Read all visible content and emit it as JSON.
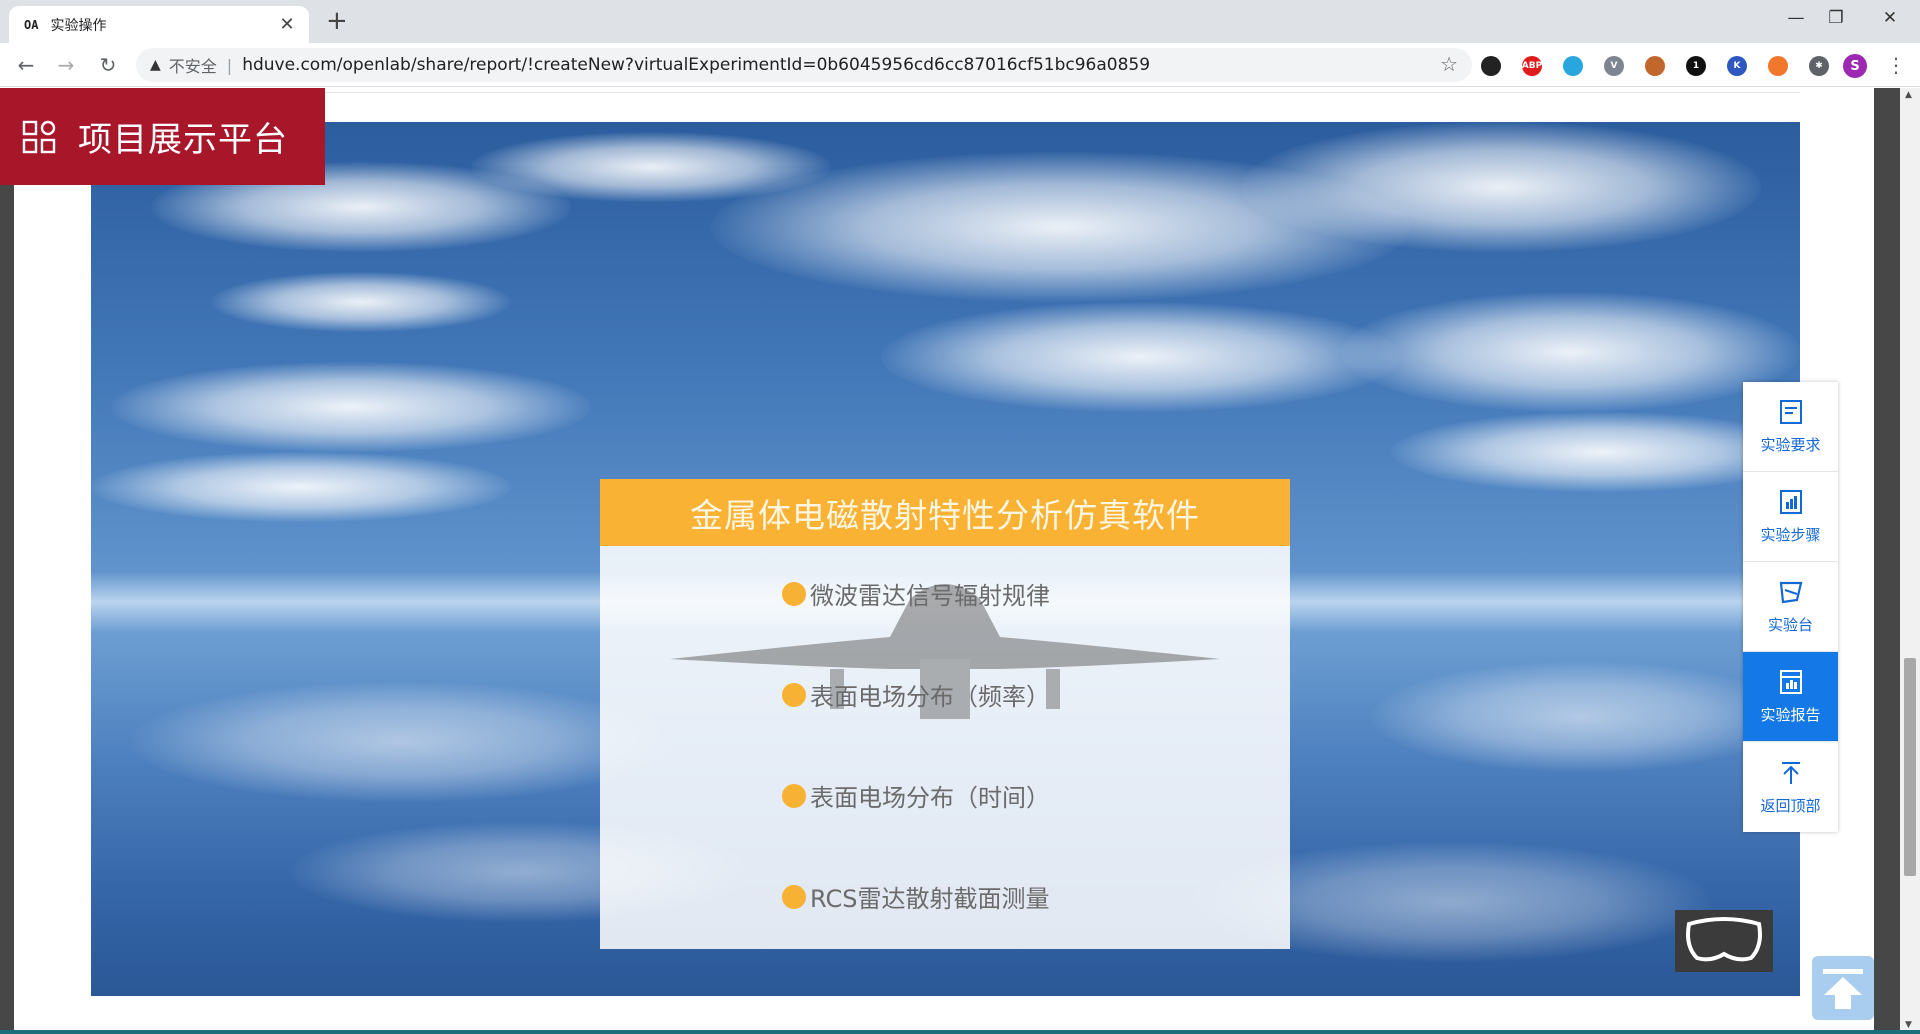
{
  "browser": {
    "tab": {
      "favicon_text": "OA",
      "title": "实验操作",
      "close": "✕"
    },
    "new_tab": "+",
    "window": {
      "minimize": "—",
      "restore": "❐",
      "close": "✕"
    },
    "nav": {
      "back": "←",
      "forward": "→",
      "reload": "↻"
    },
    "address": {
      "security_icon": "warning-triangle-icon",
      "security_text": "不安全",
      "separator": "|",
      "url": "hduve.com/openlab/share/report/!createNew?virtualExperimentId=0b6045956cd6cc87016cf51bc96a0859"
    },
    "bookmark_star": "☆",
    "extensions": [
      {
        "name": "eye-extension-icon",
        "label": "",
        "color": "#222222"
      },
      {
        "name": "abp-extension-icon",
        "label": "ABP",
        "color": "#e01b1b"
      },
      {
        "name": "bird-extension-icon",
        "label": "",
        "color": "#2aa6de"
      },
      {
        "name": "v-extension-icon",
        "label": "V",
        "color": "#7d8590"
      },
      {
        "name": "owl-extension-icon",
        "label": "",
        "color": "#c2672c"
      },
      {
        "name": "q-extension-icon",
        "label": "1",
        "color": "#111111"
      },
      {
        "name": "k-extension-icon",
        "label": "K",
        "color": "#2f57c0"
      },
      {
        "name": "lock-extension-icon",
        "label": "",
        "color": "#f0772c"
      },
      {
        "name": "puzzle-extension-icon",
        "label": "✱",
        "color": "#5f6368"
      }
    ],
    "profile_initial": "S",
    "menu": "⋮"
  },
  "brand": {
    "icon": "grid-apps-icon",
    "title": "项目展示平台"
  },
  "card": {
    "title": "金属体电磁散射特性分析仿真软件",
    "items": [
      "微波雷达信号辐射规律",
      "表面电场分布（频率）",
      "表面电场分布（时间）",
      "RCS雷达散射截面测量"
    ]
  },
  "side_panel": {
    "items": [
      {
        "label": "实验要求",
        "icon": "document-icon",
        "active": false
      },
      {
        "label": "实验步骤",
        "icon": "bar-chart-icon",
        "active": false
      },
      {
        "label": "实验台",
        "icon": "workbench-icon",
        "active": false
      },
      {
        "label": "实验报告",
        "icon": "report-icon",
        "active": true
      },
      {
        "label": "返回顶部",
        "icon": "arrow-up-icon",
        "active": false
      }
    ]
  },
  "colors": {
    "brand_red": "#a8162a",
    "card_header": "#f9b233",
    "accent_blue": "#1478e6"
  }
}
